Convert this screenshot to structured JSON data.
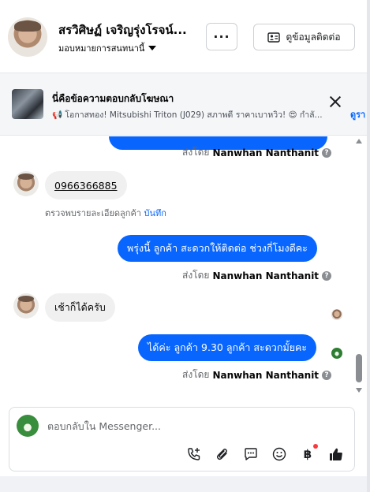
{
  "header": {
    "contact_name": "สรวิศิษฏ์ เจริญรุ่งโรจน์...",
    "assign_label": "มอบหมายการสนทนานี้",
    "more_label": "···",
    "contact_info_label": "ดูข้อมูลติดต่อ"
  },
  "ad": {
    "title": "นี่คือข้อความตอบกลับโฆษณา",
    "text": "📢 โอกาสทอง! Mitsubishi Triton (J029) สภาพดี ราคาเบาหวิว! 😍 กำลั...",
    "link": "ดูรา"
  },
  "messages": [
    {
      "id": "m1",
      "direction": "out",
      "sent_by_prefix": "ส่งโดย",
      "sent_by_name": "Nanwhan Nanthanit"
    },
    {
      "id": "m2",
      "direction": "in",
      "text": "0966366885"
    },
    {
      "id": "m3",
      "direction": "out",
      "text": "พรุ่งนี้ ลูกค้า  สะดวกให้ติดต่อ ช่วงกี่โมงดีคะ",
      "sent_by_prefix": "ส่งโดย",
      "sent_by_name": "Nanwhan Nanthanit"
    },
    {
      "id": "m4",
      "direction": "in",
      "text": "เช้าก็ได้ครับ"
    },
    {
      "id": "m5",
      "direction": "out",
      "text": "ได้ค่ะ  ลูกค้า  9.30 ลูกค้า  สะดวกมั้ยคะ",
      "sent_by_prefix": "ส่งโดย",
      "sent_by_name": "Nanwhan Nanthanit"
    }
  ],
  "save_note": {
    "text": "ตรวจพบรายละเอียดลูกค้า",
    "action": "บันทึก"
  },
  "composer": {
    "placeholder": "ตอบกลับใน Messenger...",
    "baht_symbol": "฿"
  },
  "icons": [
    "more-icon",
    "contact-card-icon",
    "close-icon",
    "help-icon",
    "call-add-icon",
    "attach-icon",
    "saved-reply-icon",
    "emoji-icon",
    "payment-icon",
    "thumbs-up-icon"
  ],
  "colors": {
    "accent": "#0866ff",
    "outgoing_bubble": "#0866ff",
    "incoming_bubble": "#f0f0f0",
    "notification_dot": "#fa383e"
  }
}
